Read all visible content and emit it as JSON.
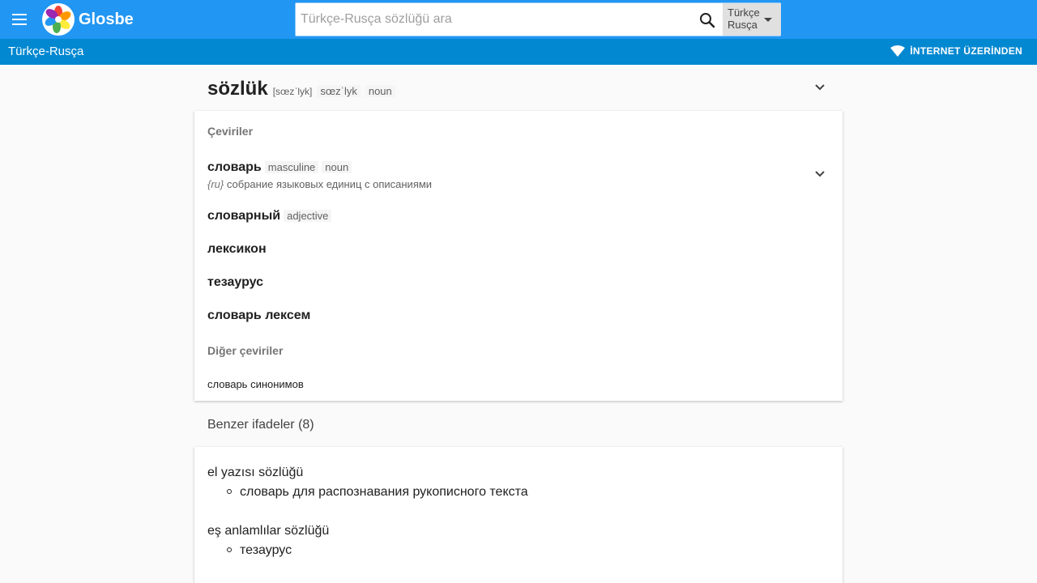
{
  "header": {
    "brand": "Glosbe",
    "search_placeholder": "Türkçe-Rusça sözlüğü ara",
    "lang_line1": "Türkçe",
    "lang_line2": "Rusça"
  },
  "subbar": {
    "pair": "Türkçe-Rusça",
    "online": "İNTERNET ÜZERİNDEN"
  },
  "entry": {
    "word": "sözlük",
    "ipa": "[sœzˈlyk]",
    "transcription": "sœzˈlyk",
    "pos": "noun"
  },
  "translations": {
    "label": "Çeviriler",
    "items": [
      {
        "word": "словарь",
        "tags": [
          "masculine",
          "noun"
        ],
        "def_lang": "{ru}",
        "definition": "собрание языковых единиц с описаниями"
      },
      {
        "word": "словарный",
        "tags": [
          "adjective"
        ]
      },
      {
        "word": "лексикон"
      },
      {
        "word": "тезаурус"
      },
      {
        "word": "словарь лексем"
      }
    ],
    "other_label": "Diğer çeviriler",
    "other_items": [
      "словарь синонимов"
    ]
  },
  "similar": {
    "heading": "Benzer ifadeler (8)",
    "items": [
      {
        "phrase": "el yazısı sözlüğü",
        "translation": "словарь для распознавания рукописного текста"
      },
      {
        "phrase": "eş anlamlılar sözlüğü",
        "translation": "тезаурус"
      }
    ]
  },
  "colors": {
    "topbar": "#2196f3",
    "subbar": "#0288d1",
    "background": "#fafafa"
  }
}
